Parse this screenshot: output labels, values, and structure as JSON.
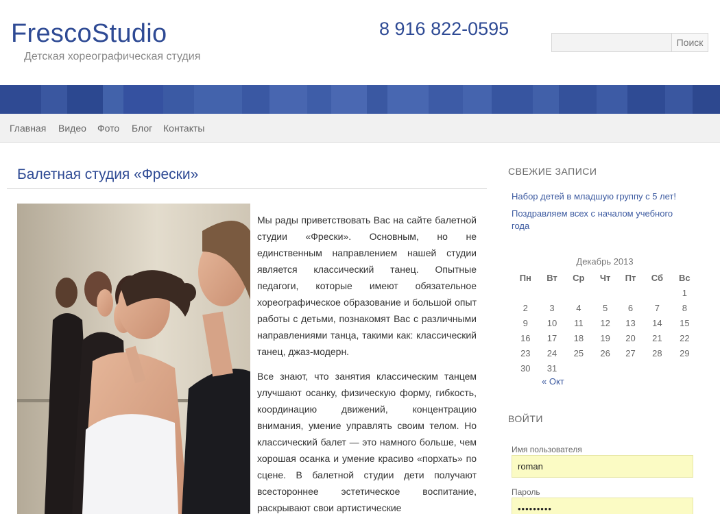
{
  "header": {
    "site_title": "FrescoStudio",
    "site_description": "Детская хореографическая студия",
    "phone": "8 916 822-0595",
    "search": {
      "value": "",
      "button_label": "Поиск"
    }
  },
  "nav": {
    "items": [
      "Главная",
      "Видео",
      "Фото",
      "Блог",
      "Контакты"
    ]
  },
  "post": {
    "title": "Балетная студия «Фрески»",
    "paragraphs": [
      "Мы рады приветствовать Вас на сайте балетной студии «Фрески». Основным, но не единственным направлением нашей студии является классический танец. Опытные педагоги, которые имеют обязательное хореографическое образование и большой опыт работы с детьми, познакомят Вас с различными направлениями танца, такими как: классический танец, джаз-модерн.",
      "Все знают, что занятия классическим танцем улучшают осанку, физическую форму, гибкость, координацию движений, концентрацию внимания, умение управлять своим телом. Но классический балет — это намного больше, чем хорошая осанка и умение красиво «порхать» по сцене. В балетной студии дети получают всестороннее эстетическое воспитание, раскрывают свои артистические"
    ]
  },
  "sidebar": {
    "recent_title": "СВЕЖИЕ ЗАПИСИ",
    "recent_posts": [
      "Набор детей в младшую группу с 5 лет!",
      "Поздравляем всех с началом учебного года"
    ],
    "calendar": {
      "caption": "Декабрь 2013",
      "weekdays": [
        "Пн",
        "Вт",
        "Ср",
        "Чт",
        "Пт",
        "Сб",
        "Вс"
      ],
      "weeks": [
        [
          "",
          "",
          "",
          "",
          "",
          "",
          "1"
        ],
        [
          "2",
          "3",
          "4",
          "5",
          "6",
          "7",
          "8"
        ],
        [
          "9",
          "10",
          "11",
          "12",
          "13",
          "14",
          "15"
        ],
        [
          "16",
          "17",
          "18",
          "19",
          "20",
          "21",
          "22"
        ],
        [
          "23",
          "24",
          "25",
          "26",
          "27",
          "28",
          "29"
        ],
        [
          "30",
          "31",
          "",
          "",
          "",
          "",
          ""
        ]
      ],
      "prev_link": "« Окт"
    },
    "login": {
      "title": "ВОЙТИ",
      "username_label": "Имя пользователя",
      "username_value": "roman",
      "password_label": "Пароль",
      "password_value": "•••••••••"
    }
  },
  "colors": {
    "brand_blue": "#2e4a94",
    "link_blue": "#3c5aa0",
    "autofill_yellow": "#fbfbc4"
  }
}
